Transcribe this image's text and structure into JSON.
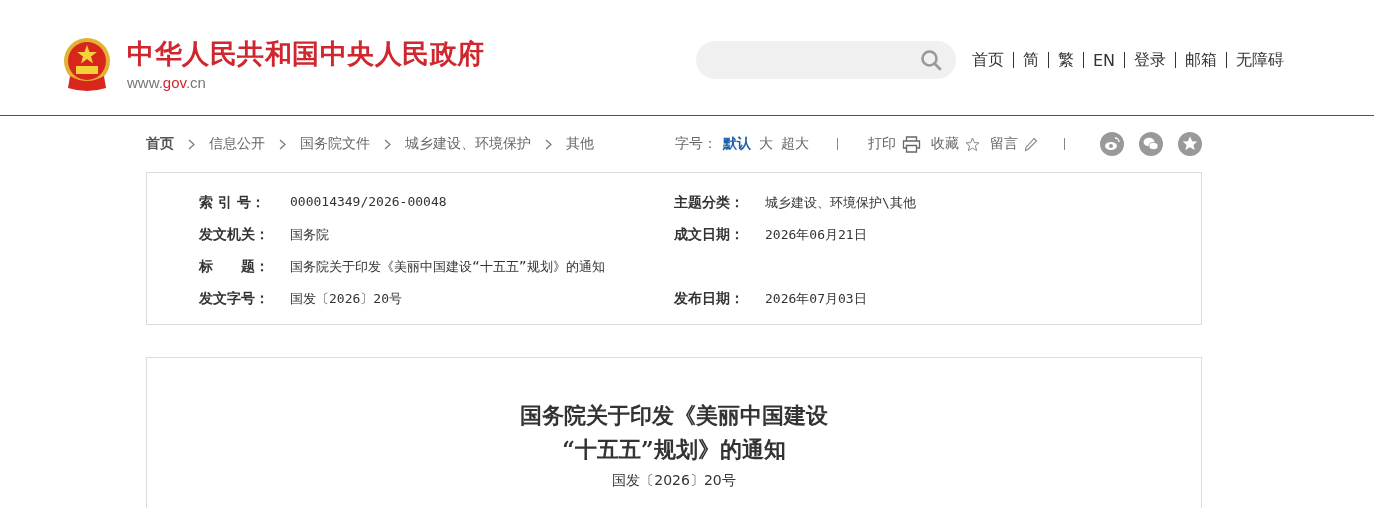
{
  "header": {
    "site_title": "中华人民共和国中央人民政府",
    "site_url_prefix": "www.",
    "site_url_domain": "gov",
    "site_url_suffix": ".cn",
    "nav": [
      "首页",
      "简",
      "繁",
      "EN",
      "登录",
      "邮箱",
      "无障碍"
    ]
  },
  "breadcrumb": [
    "首页",
    "信息公开",
    "国务院文件",
    "城乡建设、环境保护",
    "其他"
  ],
  "tools": {
    "font_label": "字号：",
    "font_sizes": [
      {
        "label": "默认",
        "selected": true
      },
      {
        "label": "大",
        "selected": false
      },
      {
        "label": "超大",
        "selected": false
      }
    ],
    "print": "打印",
    "favorite": "收藏",
    "comment": "留言"
  },
  "info": [
    {
      "label": "索 引 号：",
      "value": "000014349/2026-00048",
      "label2": "主题分类：",
      "value2": "城乡建设、环境保护\\其他"
    },
    {
      "label": "发文机关：",
      "value": "国务院",
      "label2": "成文日期：",
      "value2": "2026年06月21日"
    },
    {
      "label": "标　　题：",
      "value": "国务院关于印发《美丽中国建设“十五五”规划》的通知"
    },
    {
      "label": "发文字号：",
      "value": "国发〔2026〕20号",
      "label2": "发布日期：",
      "value2": "2026年07月03日"
    }
  ],
  "article": {
    "title_lines": [
      "国务院关于印发《美丽中国建设",
      "“十五五”规划》的通知"
    ],
    "doc_number": "国发〔2026〕20号"
  }
}
